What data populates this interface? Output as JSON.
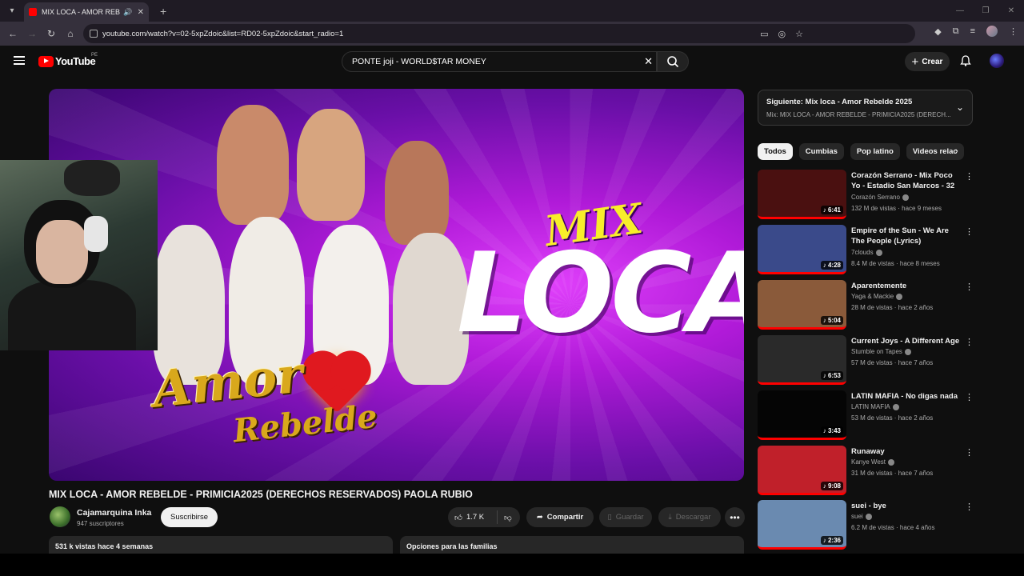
{
  "browser": {
    "tab_title": "MIX LOCA - AMOR REBELDE",
    "url": "youtube.com/watch?v=02-5xpZdoic&list=RD02-5xpZdoic&start_radio=1"
  },
  "header": {
    "logo": "YouTube",
    "country": "PE",
    "search_value": "PONTE joji - WORLD$TAR MONEY",
    "create_label": "Crear"
  },
  "player": {
    "mix_text": "MIX",
    "loca_text": "LOCA",
    "amor_text": "Amor",
    "rebelde_text": "Rebelde"
  },
  "video": {
    "title": "MIX LOCA - AMOR REBELDE - PRIMICIA2025 (DERECHOS RESERVADOS) PAOLA RUBIO",
    "channel": "Cajamarquina Inka",
    "subscribers": "947 suscriptores",
    "subscribe_label": "Suscribirse",
    "likes": "1.7 K",
    "share_label": "Compartir",
    "save_label": "Guardar",
    "download_label": "Descargar",
    "views_info": "531 k vistas  hace 4 semanas",
    "family_label": "Opciones para las familias"
  },
  "sidebar": {
    "next_label": "Siguiente: Mix loca - Amor Rebelde 2025",
    "next_sub": "Mix: MIX LOCA - AMOR REBELDE - PRIMICIA2025 (DERECH...",
    "chips": [
      "Todos",
      "Cumbias",
      "Pop latino",
      "Videos relac"
    ],
    "recommendations": [
      {
        "title": "Corazón Serrano - Mix Poco Yo - Estadio San Marcos - 32 ...",
        "channel": "Corazón Serrano",
        "meta": "132 M de vistas · hace 9 meses",
        "duration": "6:41",
        "thumb": "#4a1010"
      },
      {
        "title": "Empire of the Sun - We Are The People (Lyrics)",
        "channel": "7clouds",
        "meta": "8.4 M de vistas · hace 8 meses",
        "duration": "4:28",
        "thumb": "#3a4a8a"
      },
      {
        "title": "Aparentemente",
        "channel": "Yaga & Mackie",
        "meta": "28 M de vistas · hace 2 años",
        "duration": "5:04",
        "thumb": "#8a5a3a"
      },
      {
        "title": "Current Joys - A Different Age",
        "channel": "Stumble on Tapes",
        "meta": "57 M de vistas · hace 7 años",
        "duration": "6:53",
        "thumb": "#2a2a2a"
      },
      {
        "title": "LATIN MAFIA - No digas nada",
        "channel": "LATIN MAFIA",
        "meta": "53 M de vistas · hace 2 años",
        "duration": "3:43",
        "thumb": "#050505"
      },
      {
        "title": "Runaway",
        "channel": "Kanye West",
        "meta": "31 M de vistas · hace 7 años",
        "duration": "9:08",
        "thumb": "#c0202a"
      },
      {
        "title": "suei - bye",
        "channel": "suei",
        "meta": "6.2 M de vistas · hace 4 años",
        "duration": "2:36",
        "thumb": "#6a8ab0"
      }
    ]
  }
}
